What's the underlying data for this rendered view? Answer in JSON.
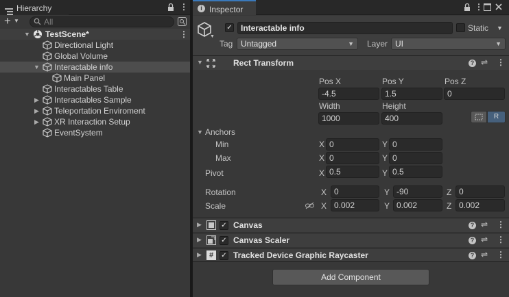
{
  "hierarchy": {
    "tab_label": "Hierarchy",
    "search_placeholder": "All",
    "scene_name": "TestScene*",
    "items": [
      {
        "label": "Directional Light"
      },
      {
        "label": "Global Volume"
      },
      {
        "label": "Interactable info"
      },
      {
        "label": "Main Panel"
      },
      {
        "label": "Interactables Table"
      },
      {
        "label": "Interactables Sample"
      },
      {
        "label": "Teleportation Enviroment"
      },
      {
        "label": "XR Interaction Setup"
      },
      {
        "label": "EventSystem"
      }
    ]
  },
  "inspector": {
    "tab_label": "Inspector",
    "object_name": "Interactable info",
    "static_label": "Static",
    "tag_label": "Tag",
    "tag_value": "Untagged",
    "layer_label": "Layer",
    "layer_value": "UI",
    "rect_transform": {
      "title": "Rect Transform",
      "posx_label": "Pos X",
      "posx": "-4.5",
      "posy_label": "Pos Y",
      "posy": "1.5",
      "posz_label": "Pos Z",
      "posz": "0",
      "width_label": "Width",
      "width": "1000",
      "height_label": "Height",
      "height": "400",
      "r_button": "R",
      "anchors_label": "Anchors",
      "min_label": "Min",
      "min_x": "0",
      "min_y": "0",
      "max_label": "Max",
      "max_x": "0",
      "max_y": "0",
      "pivot_label": "Pivot",
      "pivot_x": "0.5",
      "pivot_y": "0.5",
      "rotation_label": "Rotation",
      "rot_x": "0",
      "rot_y": "-90",
      "rot_z": "0",
      "scale_label": "Scale",
      "scale_x": "0.002",
      "scale_y": "0.002",
      "scale_z": "0.002",
      "x_axis": "X",
      "y_axis": "Y",
      "z_axis": "Z"
    },
    "components": [
      {
        "title": "Canvas"
      },
      {
        "title": "Canvas Scaler"
      },
      {
        "title": "Tracked Device Graphic Raycaster"
      }
    ],
    "add_component": "Add Component"
  },
  "colors": {
    "panel": "#383838",
    "accent": "#3a79bb",
    "selection": "#4d4d4d"
  }
}
